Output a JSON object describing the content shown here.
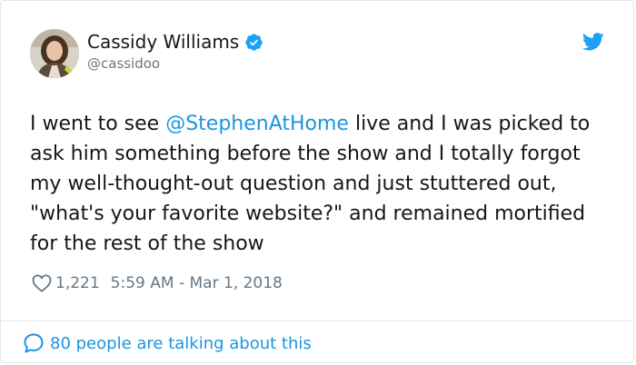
{
  "author": {
    "display_name": "Cassidy Williams",
    "handle": "@cassidoo",
    "verified": true
  },
  "tweet": {
    "text_before": "I went to see ",
    "mention": "@StephenAtHome",
    "text_after": " live and I was picked to ask him something before the show and I totally forgot my well-thought-out question and just stuttered out, \"what's your favorite website?\" and remained mortified for the rest of the show"
  },
  "meta": {
    "likes": "1,221",
    "timestamp": "5:59 AM - Mar 1, 2018"
  },
  "conversation": {
    "label": "80 people are talking about this"
  },
  "icons": {
    "verified": "verified-badge-icon",
    "brand": "twitter-bird-icon",
    "like": "heart-icon",
    "reply": "speech-bubble-icon"
  },
  "colors": {
    "accent": "#1b95e0",
    "verified": "#1da1f2",
    "text": "#14171a",
    "muted": "#657786",
    "border": "#e1e8ed"
  }
}
